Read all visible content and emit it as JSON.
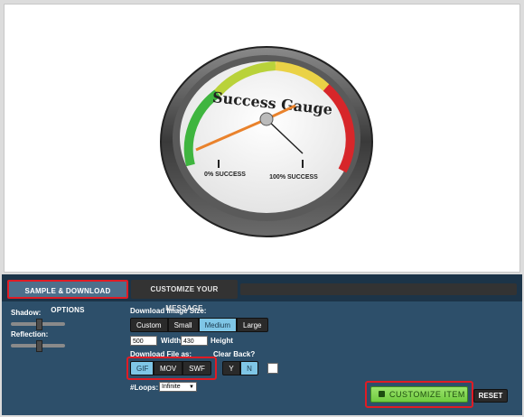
{
  "gauge": {
    "title": "Success Gauge",
    "min_label": "0% SUCCESS",
    "max_label": "100% SUCCESS"
  },
  "tabs": {
    "sample": "SAMPLE & DOWNLOAD OPTIONS",
    "customize": "CUSTOMIZE YOUR MESSAGE"
  },
  "options": {
    "shadow_label": "Shadow:",
    "reflection_label": "Reflection:",
    "size_label": "Download Image Size:",
    "sizes": [
      "Custom",
      "Small",
      "Medium",
      "Large"
    ],
    "selected_size": "Medium",
    "width_value": "500",
    "width_label": "Width",
    "height_value": "430",
    "height_label": "Height",
    "file_label": "Download File as:",
    "formats": [
      "GIF",
      "MOV",
      "SWF"
    ],
    "selected_format": "GIF",
    "clear_back_label": "Clear Back?",
    "yes": "Y",
    "no": "N",
    "loops_label": "#Loops:",
    "loops_value": "Infinite"
  },
  "actions": {
    "customize": "CUSTOMIZE ITEM",
    "reset": "RESET"
  },
  "colors": {
    "accent_red": "#e01b24",
    "active_blue": "#7fc6e6",
    "green": "#7ad34a",
    "panel": "#2d4f6a"
  }
}
